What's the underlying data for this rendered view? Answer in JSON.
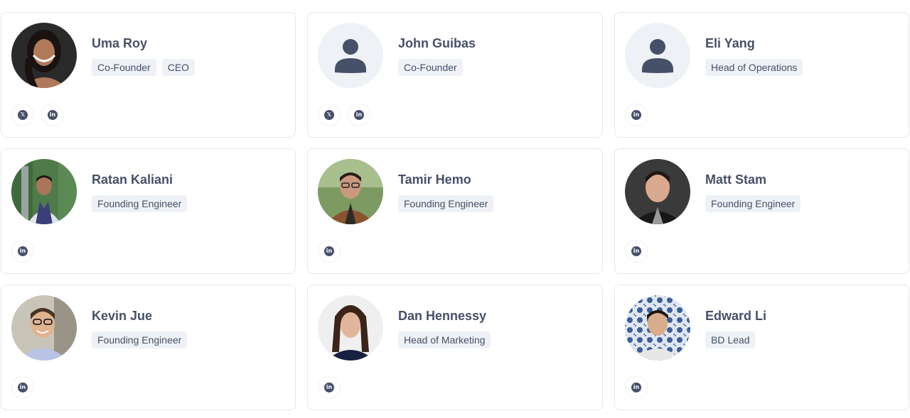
{
  "colors": {
    "text": "#475069",
    "tag_bg": "#eef1f6",
    "card_border": "#e5e7eb",
    "placeholder_bg": "#eef1f6"
  },
  "members": [
    {
      "name": "Uma Roy",
      "tags": [
        "Co-Founder",
        "CEO"
      ],
      "socials": [
        "x-icon",
        "linkedin-icon"
      ],
      "photo": "photo"
    },
    {
      "name": "John Guibas",
      "tags": [
        "Co-Founder"
      ],
      "socials": [
        "x-icon",
        "linkedin-icon"
      ],
      "photo": "placeholder"
    },
    {
      "name": "Eli Yang",
      "tags": [
        "Head of Operations"
      ],
      "socials": [
        "linkedin-icon"
      ],
      "photo": "placeholder"
    },
    {
      "name": "Ratan Kaliani",
      "tags": [
        "Founding Engineer"
      ],
      "socials": [
        "linkedin-icon"
      ],
      "photo": "photo"
    },
    {
      "name": "Tamir Hemo",
      "tags": [
        "Founding Engineer"
      ],
      "socials": [
        "linkedin-icon"
      ],
      "photo": "photo"
    },
    {
      "name": "Matt Stam",
      "tags": [
        "Founding Engineer"
      ],
      "socials": [
        "linkedin-icon"
      ],
      "photo": "photo"
    },
    {
      "name": "Kevin Jue",
      "tags": [
        "Founding Engineer"
      ],
      "socials": [
        "linkedin-icon"
      ],
      "photo": "photo"
    },
    {
      "name": "Dan Hennessy",
      "tags": [
        "Head of Marketing"
      ],
      "socials": [
        "linkedin-icon"
      ],
      "photo": "photo"
    },
    {
      "name": "Edward Li",
      "tags": [
        "BD Lead"
      ],
      "socials": [
        "linkedin-icon"
      ],
      "photo": "photo"
    }
  ]
}
